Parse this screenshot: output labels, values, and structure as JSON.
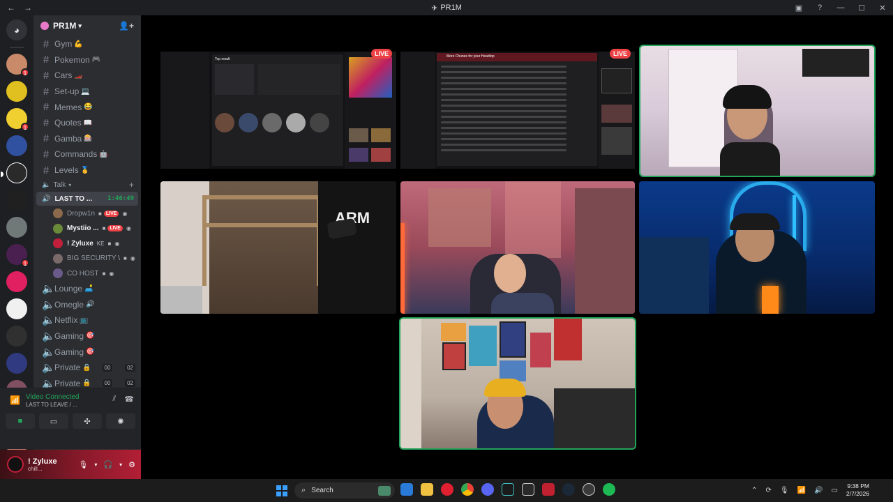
{
  "window": {
    "title": "PR1M",
    "back": "←",
    "forward": "→"
  },
  "server": {
    "name": "PR1M"
  },
  "channels": [
    {
      "name": "Gym",
      "emoji": "💪"
    },
    {
      "name": "Pokemon",
      "emoji": "🎮"
    },
    {
      "name": "Cars",
      "emoji": "🏎️"
    },
    {
      "name": "Set-up",
      "emoji": "💻"
    },
    {
      "name": "Memes",
      "emoji": "😂"
    },
    {
      "name": "Quotes",
      "emoji": "📖"
    },
    {
      "name": "Gamba",
      "emoji": "🎰"
    },
    {
      "name": "Commands",
      "emoji": "🤖"
    },
    {
      "name": "Levels",
      "emoji": "🥇"
    }
  ],
  "voice_category": {
    "name": "Talk"
  },
  "active_voice": {
    "name": "LAST TO ...",
    "timer": "1:46:49"
  },
  "voice_users": [
    {
      "name": "Dropw1n",
      "live": "LIVE",
      "color": "#8a6a4a"
    },
    {
      "name": "Mystiio ...",
      "live": "LIVE",
      "color": "#6a8a3a"
    },
    {
      "name": "! Zyluxe",
      "live": "",
      "color": "#c21f3a",
      "note": "KE"
    },
    {
      "name": "BIG SECURITY W...",
      "live": "",
      "color": "#7a6a6a"
    },
    {
      "name": "CO HOST",
      "live": "",
      "color": "#6a5a8a"
    }
  ],
  "voice_channels": [
    {
      "name": "Lounge",
      "emoji": "🛋️",
      "tag1": "",
      "tag2": ""
    },
    {
      "name": "Omegle",
      "emoji": "🔊",
      "tag1": "",
      "tag2": ""
    },
    {
      "name": "Netflix",
      "emoji": "📺",
      "tag1": "",
      "tag2": ""
    },
    {
      "name": "Gaming",
      "emoji": "🎯",
      "tag1": "",
      "tag2": ""
    },
    {
      "name": "Gaming",
      "emoji": "🎯",
      "tag1": "",
      "tag2": ""
    },
    {
      "name": "Private",
      "emoji": "🔒",
      "tag1": "00",
      "tag2": "02"
    },
    {
      "name": "Private",
      "emoji": "🔒",
      "tag1": "00",
      "tag2": "02"
    }
  ],
  "voice_panel": {
    "status": "Video Connected",
    "channel": "LAST TO LEAVE / ..."
  },
  "user_panel": {
    "name": "! Zyluxe",
    "status": "chill..."
  },
  "stage_tiles": [
    {
      "kind": "screen",
      "live": "LIVE",
      "title": "Top result"
    },
    {
      "kind": "screen",
      "live": "LIVE",
      "title": "More Chunes for your Headtop"
    },
    {
      "kind": "camera",
      "live": "",
      "speaking": true
    },
    {
      "kind": "camera",
      "live": "",
      "speaking": false
    },
    {
      "kind": "camera",
      "live": "",
      "speaking": false
    },
    {
      "kind": "camera",
      "live": "",
      "speaking": false
    },
    {
      "kind": "camera",
      "live": "",
      "speaking": true
    }
  ],
  "taskbar": {
    "search_placeholder": "Search",
    "time": "9:38 PM",
    "date": "2/7/2026"
  },
  "colors": {
    "accent_green": "#23a55a",
    "live_red": "#ed4245",
    "blurple": "#5865f2"
  }
}
